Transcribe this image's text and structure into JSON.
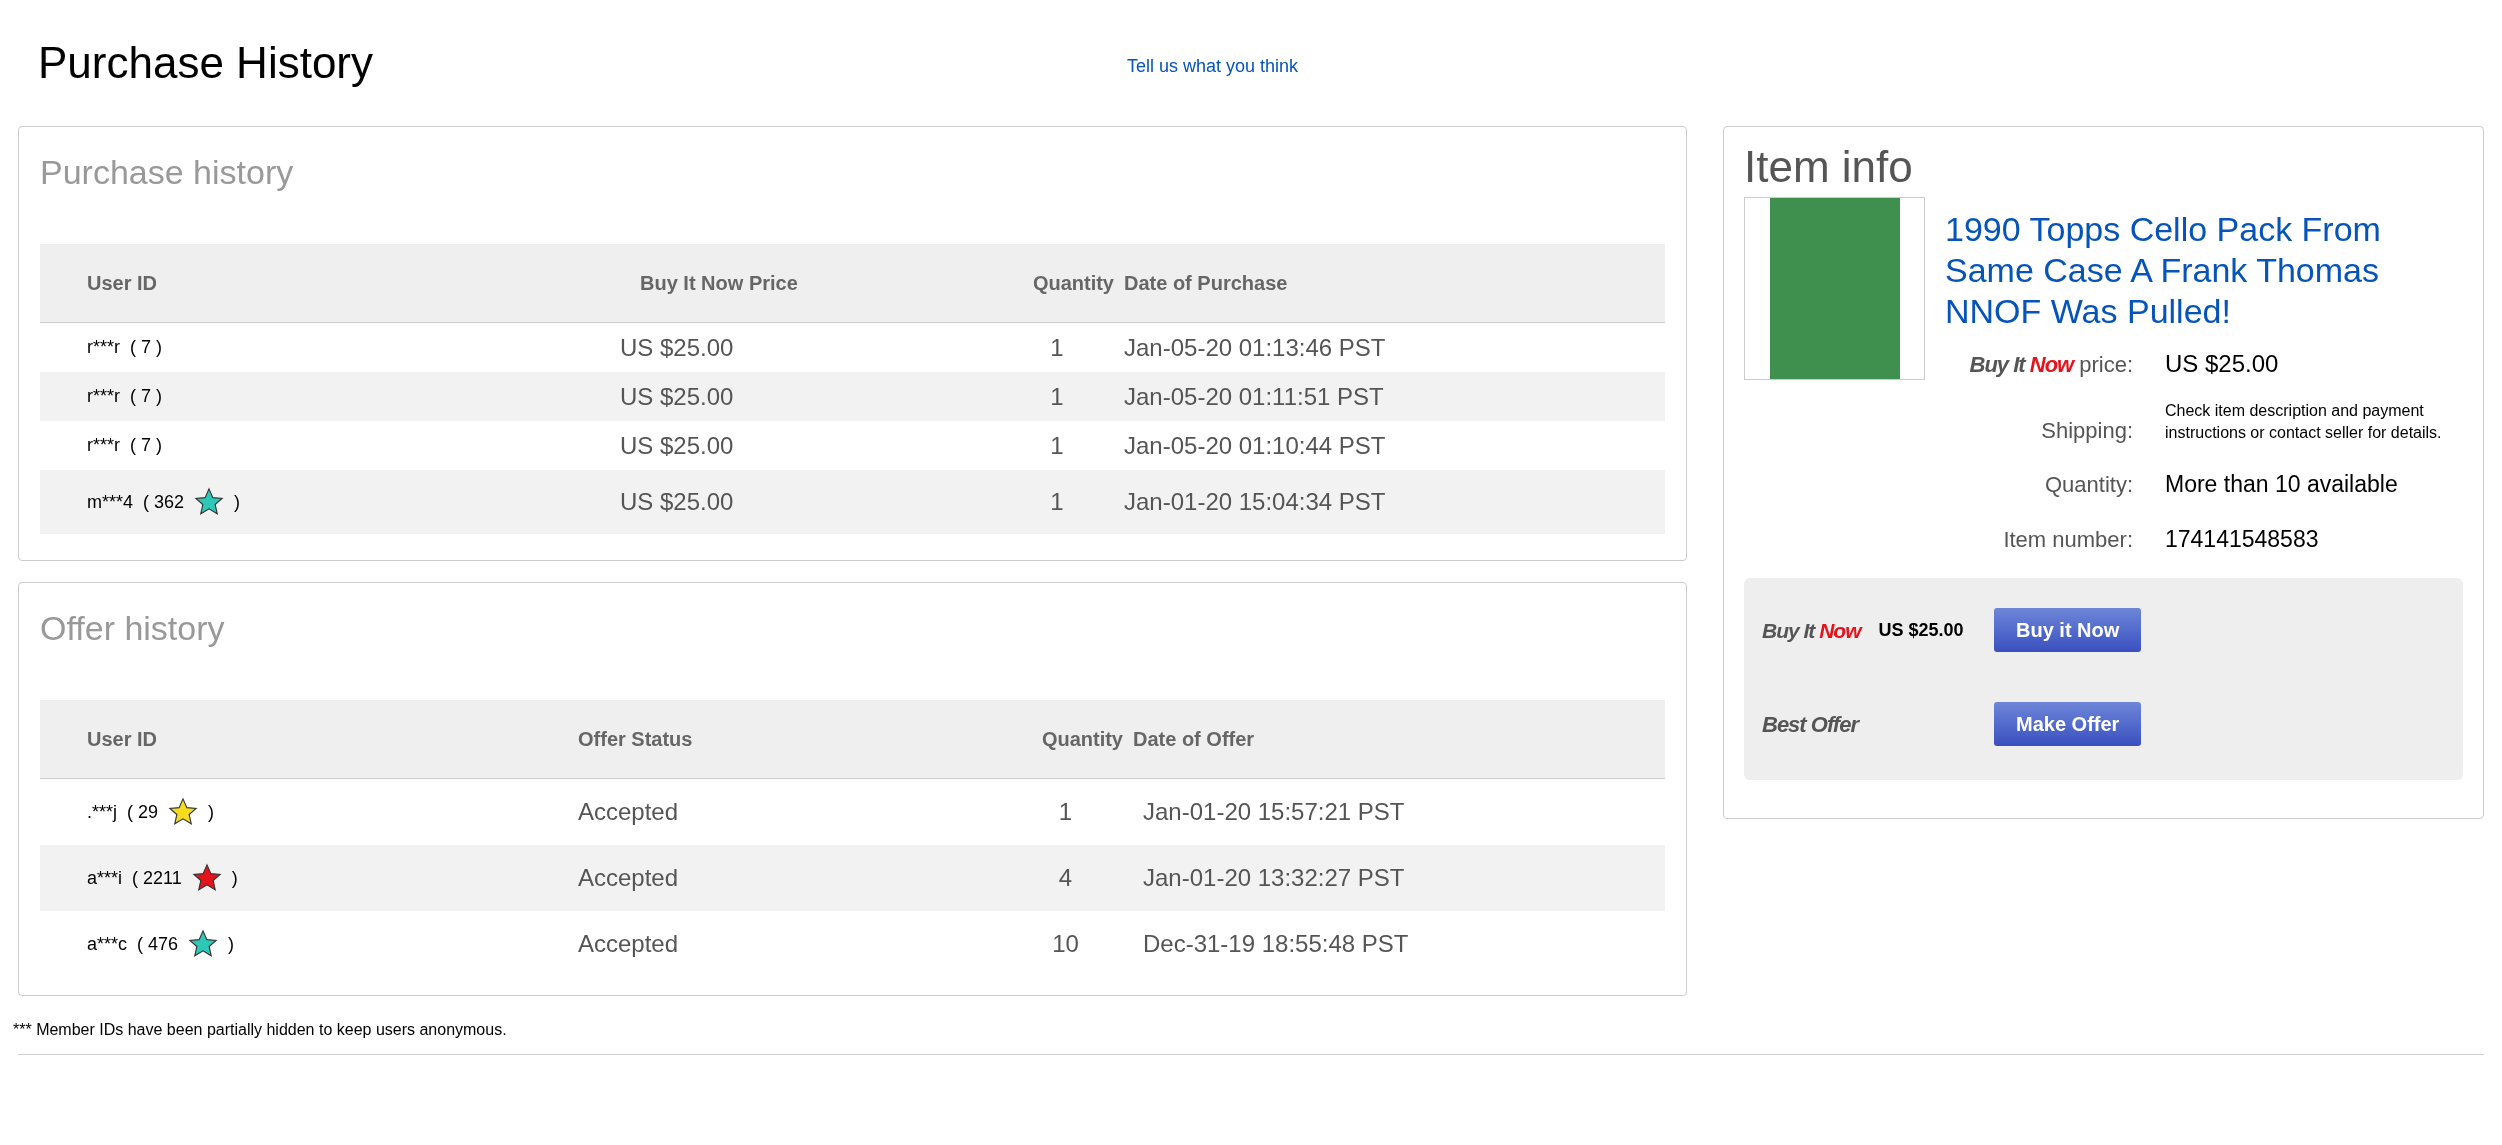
{
  "page_title": "Purchase History",
  "feedback_link": "Tell us what you think",
  "purchase_history": {
    "title": "Purchase history",
    "columns": [
      "User ID",
      "Buy It Now Price",
      "Quantity",
      "Date of Purchase"
    ],
    "rows": [
      {
        "user": "r***r",
        "feedback": [
          "( 7 )"
        ],
        "price": "US $25.00",
        "quantity": "1",
        "date": "Jan-05-20 01:13:46 PST"
      },
      {
        "user": "r***r",
        "feedback": [
          "( 7 )"
        ],
        "price": "US $25.00",
        "quantity": "1",
        "date": "Jan-05-20 01:11:51 PST"
      },
      {
        "user": "r***r",
        "feedback": [
          "( 7 )"
        ],
        "price": "US $25.00",
        "quantity": "1",
        "date": "Jan-05-20 01:10:44 PST"
      },
      {
        "user": "m***4",
        "feedback": [
          "( 362",
          ")"
        ],
        "color": "#2ec8b8",
        "price": "US $25.00",
        "quantity": "1",
        "date": "Jan-01-20 15:04:34 PST"
      }
    ]
  },
  "offer_history": {
    "title": "Offer history",
    "columns": [
      "User ID",
      "Offer Status",
      "Quantity",
      "Date of Offer"
    ],
    "rows": [
      {
        "user": ".***j",
        "feedback": [
          "( 29",
          ")"
        ],
        "color": "#f5dc1e",
        "status": "Accepted",
        "quantity": "1",
        "date": "Jan-01-20 15:57:21 PST"
      },
      {
        "user": "a***i",
        "feedback": [
          "( 2211",
          ")"
        ],
        "color": "#e3141c",
        "status": "Accepted",
        "quantity": "4",
        "date": "Jan-01-20 13:32:27 PST"
      },
      {
        "user": "a***c",
        "feedback": [
          "( 476",
          ")"
        ],
        "color": "#2ec8b8",
        "status": "Accepted",
        "quantity": "10",
        "date": "Dec-31-19 18:55:48 PST"
      }
    ]
  },
  "footnote": "*** Member IDs have been partially hidden to keep users anonymous.",
  "item_info": {
    "title": "Item info",
    "item_title": "1990 Topps Cello Pack From Same Case A Frank Thomas NNOF Was Pulled!",
    "bin_logo": [
      "Buy It",
      "Now"
    ],
    "details": [
      {
        "kind": "price",
        "label": "price:",
        "value": "US $25.00"
      },
      {
        "kind": "small",
        "label": "Shipping:",
        "value": "Check item description and payment instructions or contact seller for details."
      },
      {
        "kind": "plain",
        "label": "Quantity:",
        "value": "More than 10 available"
      },
      {
        "kind": "plain",
        "label": "Item number:",
        "value": "174141548583"
      }
    ],
    "actions": [
      {
        "kind": "bin",
        "logo": [
          "Buy It",
          "Now"
        ],
        "price": "US $25.00",
        "button": "Buy it Now"
      },
      {
        "kind": "offer",
        "label": "Best Offer",
        "button": "Make Offer"
      }
    ]
  }
}
